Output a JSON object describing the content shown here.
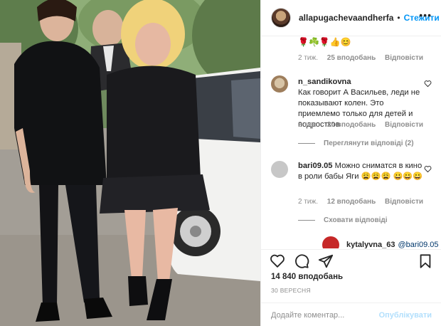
{
  "post": {
    "username": "allapugachevaandherfa",
    "follow_label": "Стежити",
    "more_label": "•••"
  },
  "comments": [
    {
      "text": "🌹☘️🌹👍😊",
      "time": "2 тиж.",
      "likes": "25 вподобань",
      "reply": "Відповісти"
    },
    {
      "user": "n_sandikovna",
      "text": "Как говорит А Васильев, леди не показывают колен. Это приемлемо только для детей и подростков",
      "time": "2 тиж.",
      "likes": "20 вподобань",
      "reply": "Відповісти",
      "view_replies": "Переглянути відповіді (2)"
    },
    {
      "user": "bari09.05",
      "text": "Можно сниматся в кино в роли бабы Яги 😩😩😩 😀😀😀",
      "time": "2 тиж.",
      "likes": "12 вподобань",
      "reply": "Відповісти",
      "hide_replies": "Сховати відповіді"
    }
  ],
  "reply": {
    "user": "kytalyvna_63",
    "mention": "@bari09.05"
  },
  "actions": {
    "likes": "14 840 вподобань",
    "date": "30 ВЕРЕСНЯ",
    "comment_placeholder": "Додайте коментар...",
    "publish_label": "Опублікувати"
  },
  "colors": {
    "accent": "#0095f6",
    "muted": "#8e8e8e",
    "publish_disabled": "#b2dffc"
  }
}
